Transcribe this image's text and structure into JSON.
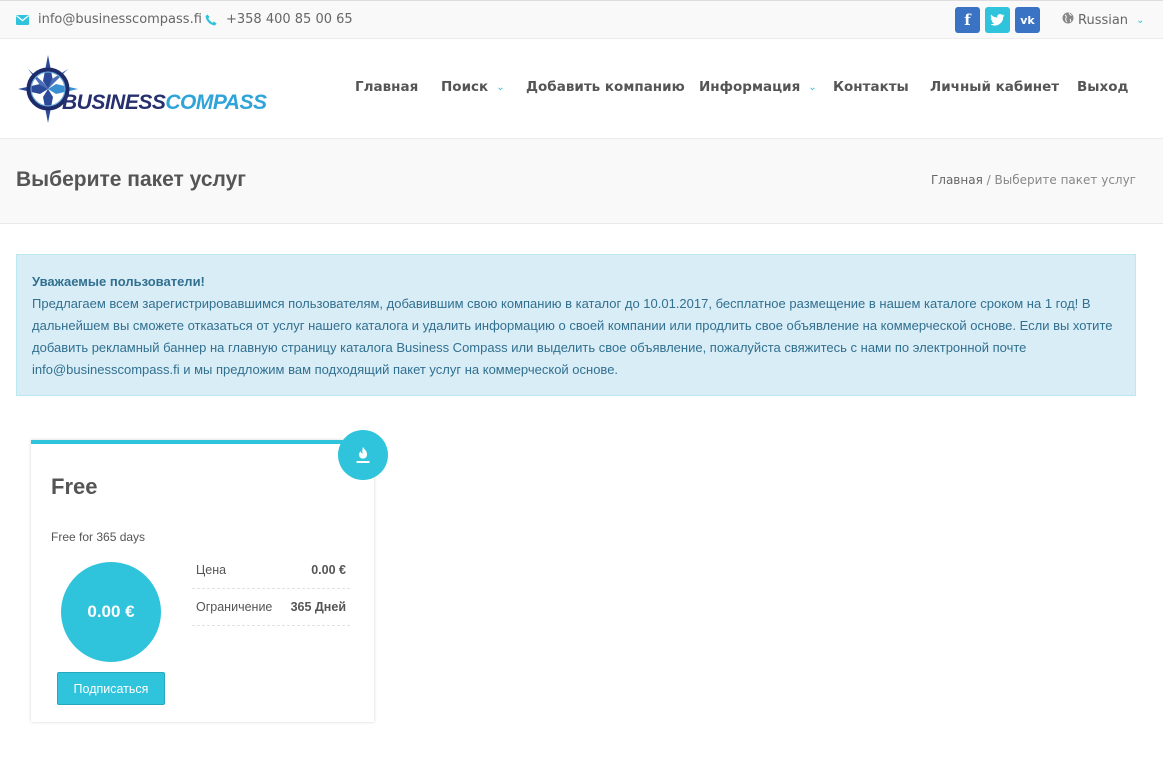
{
  "topbar": {
    "email": "info@businesscompass.fi",
    "phone": "+358 400 85 00 65",
    "social": [
      "f",
      "vk"
    ],
    "language": "Russian"
  },
  "header": {
    "logo_part1": "BUSINESS",
    "logo_part2": "COMPASS",
    "nav": [
      {
        "label": "Главная"
      },
      {
        "label": "Поиск"
      },
      {
        "label": "Добавить компанию"
      },
      {
        "label": "Информация"
      },
      {
        "label": "Контакты"
      },
      {
        "label": "Личный кабинет"
      },
      {
        "label": "Выход"
      }
    ]
  },
  "page": {
    "title": "Выберите пакет услуг",
    "breadcrumb_home": "Главная",
    "breadcrumb_sep": " / ",
    "breadcrumb_current": "Выберите пакет услуг"
  },
  "notice": {
    "heading": "Уважаемые пользователи!",
    "body": "Предлагаем всем зарегистрировавшимся пользователям, добавившим свою компанию в каталог до 10.01.2017, бесплатное размещение в нашем каталоге сроком на 1 год! В дальнейшем вы сможете отказаться от услуг нашего каталога и удалить информацию о своей компании или продлить свое объявление на коммерческой основе. Если вы хотите добавить рекламный баннер на главную страницу каталога Business Compass или выделить свое объявление, пожалуйста свяжитесь с нами по электронной почте info@businesscompass.fi и мы предложим вам подходящий пакет услуг на коммерческой основе."
  },
  "plan": {
    "name": "Free",
    "description": "Free for 365 days",
    "price_display": "0.00 €",
    "subscribe_label": "Подписаться",
    "price_label": "Цена",
    "price_value": "0.00 €",
    "limit_label": "Ограничение",
    "limit_value": "365 Дней"
  },
  "colors": {
    "accent": "#2fc3dc",
    "facebook": "#3b73c4",
    "vk": "#3b73c4",
    "notice_bg": "#d9edf7",
    "notice_text": "#31708f"
  }
}
